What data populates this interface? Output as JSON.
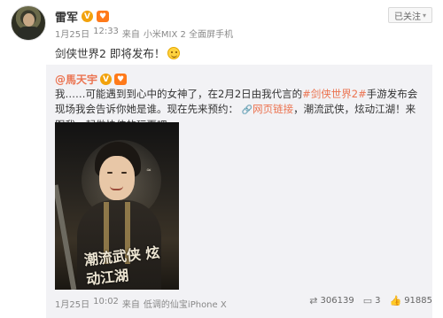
{
  "post": {
    "author": "雷军",
    "date": "1月25日",
    "time": "12:33",
    "source_prefix": "来自",
    "source": "小米MIX 2 全面屏手机",
    "text": "剑侠世界2 即将发布！"
  },
  "follow": {
    "label": "已关注"
  },
  "repost": {
    "author": "@馬天宇",
    "text_before": "我……可能遇到到心中的女神了，在2月2日由我代言的",
    "topic": "#剑侠世界2#",
    "text_mid": "手游发布会现场我会告诉你她是谁。现在先来预约：",
    "link": "网页链接",
    "text_after": "，潮流武侠，炫动江湖！来跟我一起做快侠的玩耍吧。",
    "poster_text": "潮流武侠 炫动江湖",
    "date": "1月25日",
    "time": "10:02",
    "source_prefix": "来自",
    "source": "低调的仙宝iPhone X",
    "reposts": "306139",
    "comments": "3",
    "likes": "91885"
  },
  "icons": {
    "verified": "verified-v-icon",
    "heart_badge": "heart-badge-icon",
    "link": "link-icon",
    "repost": "repost-icon",
    "comment": "comment-icon",
    "like": "thumb-up-icon",
    "caret": "chevron-down-icon"
  },
  "colors": {
    "accent": "#eb7350",
    "verified": "#f2a20c",
    "repost_bg": "#f2f2f5"
  }
}
